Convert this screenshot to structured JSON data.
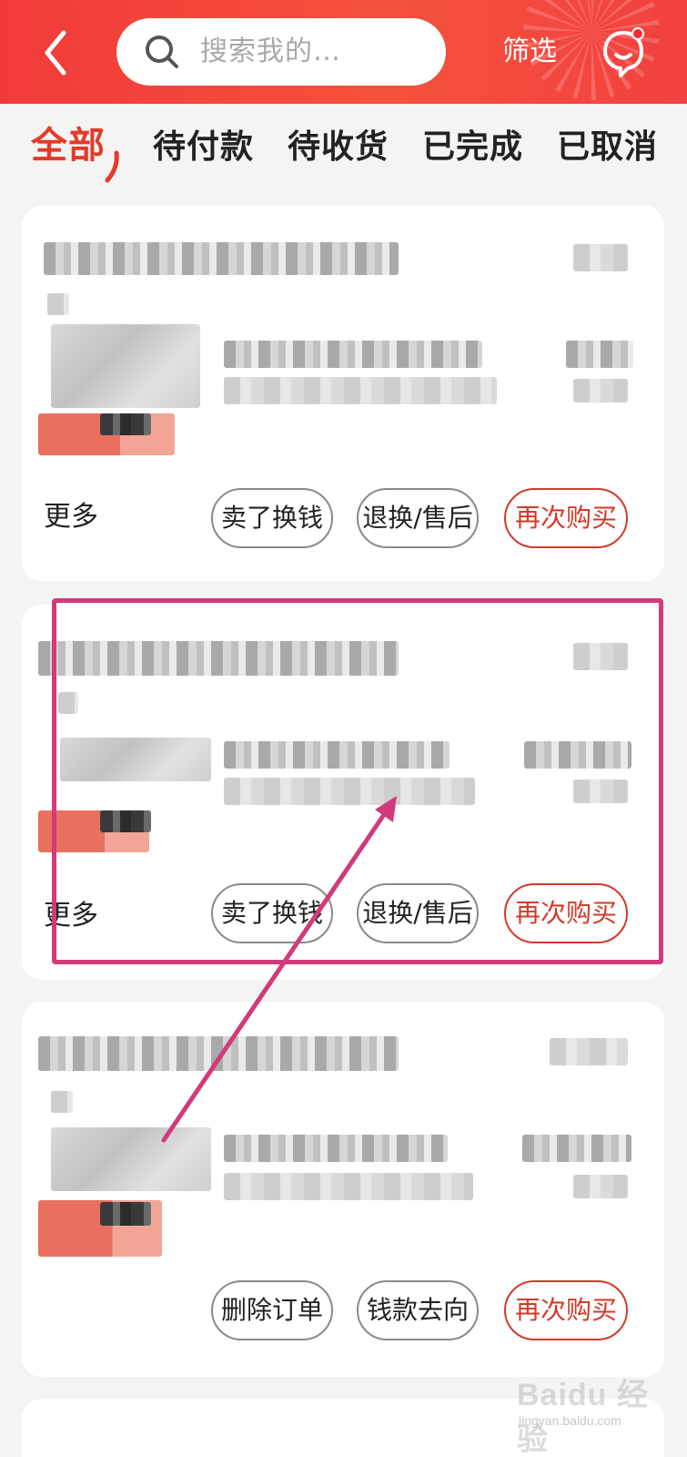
{
  "header": {
    "search_placeholder": "搜索我的…",
    "filter_label": "筛选"
  },
  "tabs": [
    {
      "label": "全部",
      "active": true
    },
    {
      "label": "待付款",
      "active": false
    },
    {
      "label": "待收货",
      "active": false
    },
    {
      "label": "已完成",
      "active": false
    },
    {
      "label": "已取消",
      "active": false
    }
  ],
  "orders": [
    {
      "more_label": "更多",
      "actions": [
        "卖了换钱",
        "退换/售后",
        "再次购买"
      ]
    },
    {
      "more_label": "更多",
      "actions": [
        "卖了换钱",
        "退换/售后",
        "再次购买"
      ]
    },
    {
      "more_label": "",
      "actions": [
        "删除订单",
        "钱款去向",
        "再次购买"
      ]
    }
  ],
  "watermark": {
    "logo": "Baidu 经验",
    "url": "jingyan.baidu.com"
  },
  "colors": {
    "accent": "#e33a2a",
    "header_bg": "#f4493b",
    "annotation": "#d23a7a"
  }
}
